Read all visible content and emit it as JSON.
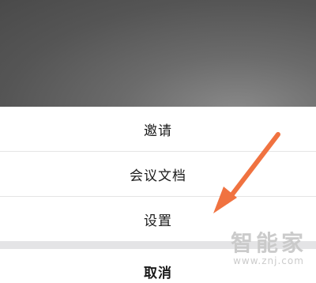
{
  "sheet": {
    "items": [
      {
        "label": "邀请"
      },
      {
        "label": "会议文档"
      },
      {
        "label": "设置"
      }
    ],
    "cancel_label": "取消"
  },
  "annotation": {
    "icon": "arrow-annotation-icon",
    "color": "#f07240"
  },
  "watermark": {
    "text": "智能家",
    "url": "www.znj.com"
  }
}
